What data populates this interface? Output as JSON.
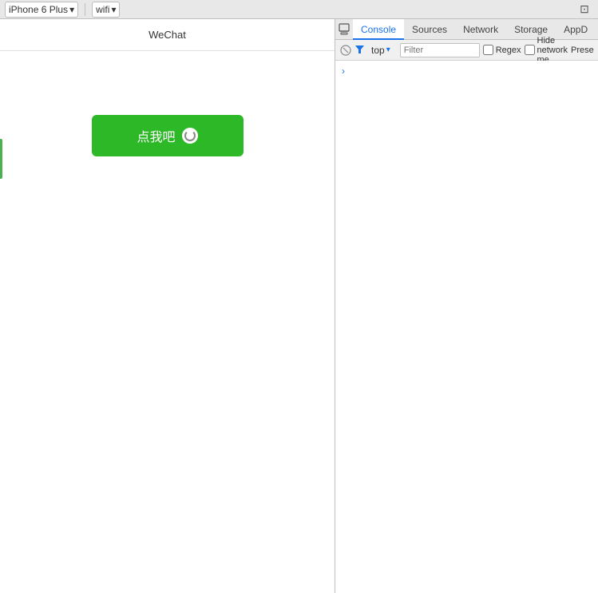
{
  "toolbar": {
    "device_label": "iPhone 6 Plus",
    "network_label": "wifi",
    "chevron_down": "▾"
  },
  "simulator": {
    "title": "WeChat",
    "button_label": "点我吧"
  },
  "devtools": {
    "tabs": [
      {
        "id": "console",
        "label": "Console",
        "active": true
      },
      {
        "id": "sources",
        "label": "Sources",
        "active": false
      },
      {
        "id": "network",
        "label": "Network",
        "active": false
      },
      {
        "id": "storage",
        "label": "Storage",
        "active": false
      },
      {
        "id": "appd",
        "label": "AppD",
        "active": false
      }
    ],
    "console": {
      "context_value": "top",
      "filter_placeholder": "Filter",
      "regex_label": "Regex",
      "hide_network_label": "Hide network me",
      "preserve_label": "Prese",
      "chevron": "›"
    }
  }
}
